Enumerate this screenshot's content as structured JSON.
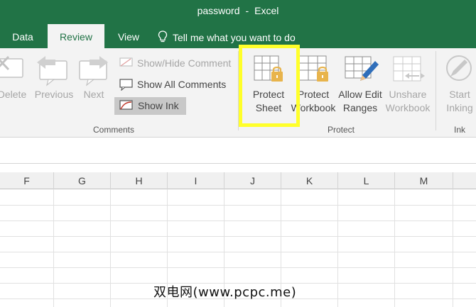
{
  "window": {
    "doc_name": "password",
    "separator": "-",
    "app_name": "Excel"
  },
  "tabs": {
    "data": "Data",
    "review": "Review",
    "view": "View"
  },
  "tellme": {
    "text": "Tell me what you want to do"
  },
  "comments_group": {
    "label": "Comments",
    "delete": "Delete",
    "previous": "Previous",
    "next": "Next",
    "show_hide": "Show/Hide Comment",
    "show_all": "Show All Comments",
    "show_ink": "Show Ink"
  },
  "protect_group": {
    "label": "Protect",
    "protect_sheet": [
      "Protect",
      "Sheet"
    ],
    "protect_workbook": [
      "Protect",
      "Workbook"
    ],
    "allow_edit": [
      "Allow Edit",
      "Ranges"
    ],
    "unshare": [
      "Unshare",
      "Workbook"
    ]
  },
  "ink_group": {
    "label": "Ink",
    "start_inking": [
      "Start",
      "Inking"
    ]
  },
  "columns": [
    "F",
    "G",
    "H",
    "I",
    "J",
    "K",
    "L",
    "M"
  ],
  "watermark": "双电网(www.pcpc.me)",
  "colors": {
    "excel_green": "#217346",
    "highlight": "#ffff2a",
    "lock": "#e8b44c",
    "pen": "#2f6eba"
  }
}
